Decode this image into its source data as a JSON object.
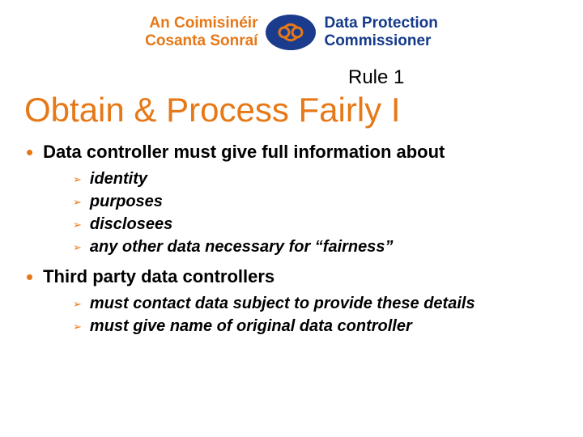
{
  "header": {
    "left_line1": "An Coimisinéir",
    "left_line2": "Cosanta Sonraí",
    "right_line1": "Data Protection",
    "right_line2": "Commissioner"
  },
  "rule_label": "Rule 1",
  "title": "Obtain & Process Fairly I",
  "bullets": [
    {
      "text": "Data controller must give full information about",
      "subs": [
        "identity",
        "purposes",
        "disclosees",
        "any other data necessary for “fairness”"
      ]
    },
    {
      "text": "Third party data controllers",
      "subs": [
        "must contact data subject to provide these details",
        "must give name of original data controller"
      ]
    }
  ]
}
